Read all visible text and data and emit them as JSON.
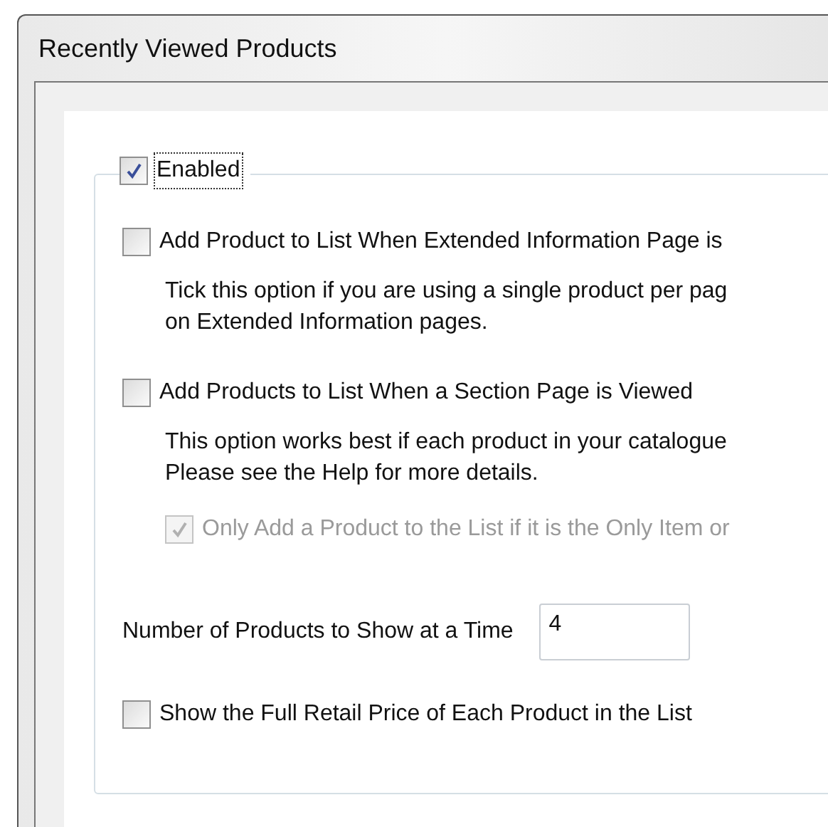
{
  "window": {
    "title": "Recently Viewed Products"
  },
  "group": {
    "header": {
      "label": "Enabled",
      "checked": true,
      "focused": true
    },
    "options": [
      {
        "kind": "checkbox",
        "label": "Add Product to List When Extended Information Page is",
        "checked": false,
        "disabled": false,
        "description": [
          "Tick this option if you are using a single product per pag",
          "on Extended Information pages."
        ]
      },
      {
        "kind": "checkbox",
        "label": "Add Products to List When a Section Page is Viewed",
        "checked": false,
        "disabled": false,
        "description": [
          "This option works best if each product in your catalogue",
          "Please see the Help for more details."
        ]
      },
      {
        "kind": "subcheckbox",
        "label": "Only Add a Product to the List if it is the Only Item or",
        "checked": true,
        "disabled": true
      },
      {
        "kind": "number",
        "label": "Number of Products to Show at a Time",
        "value": "4"
      },
      {
        "kind": "checkbox",
        "label": "Show the Full Retail Price of Each Product in the List",
        "checked": false,
        "disabled": false
      }
    ]
  }
}
